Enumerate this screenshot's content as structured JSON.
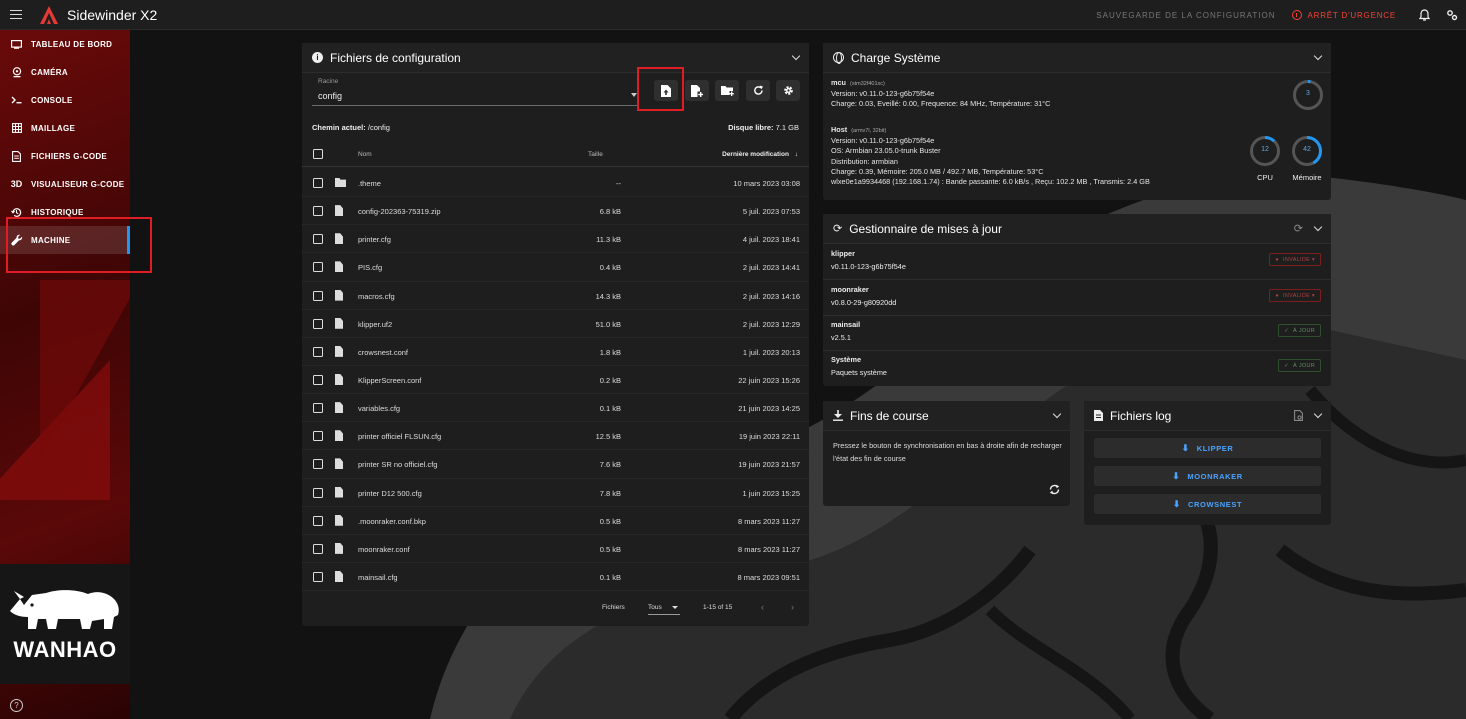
{
  "app": {
    "title": "Sidewinder X2"
  },
  "topbar": {
    "save_config": "SAUVEGARDE DE LA CONFIGURATION",
    "emergency_stop": "ARRÊT D'URGENCE"
  },
  "sidebar": {
    "items": [
      {
        "label": "TABLEAU DE BORD",
        "icon": "dashboard-icon"
      },
      {
        "label": "CAMÉRA",
        "icon": "webcam-icon"
      },
      {
        "label": "CONSOLE",
        "icon": "console-icon"
      },
      {
        "label": "MAILLAGE",
        "icon": "grid-icon"
      },
      {
        "label": "FICHIERS G-CODE",
        "icon": "file-document-icon"
      },
      {
        "label": "VISUALISEUR G-CODE",
        "icon": "3d-icon"
      },
      {
        "label": "HISTORIQUE",
        "icon": "history-icon"
      },
      {
        "label": "MACHINE",
        "icon": "wrench-icon"
      }
    ],
    "active": "MACHINE",
    "brand": "WANHAO",
    "icon_3d_text": "3D"
  },
  "files": {
    "title": "Fichiers de configuration",
    "root_label": "Racine",
    "root_value": "config",
    "current_path_label": "Chemin actuel:",
    "current_path": "/config",
    "free_disk_label": "Disque libre:",
    "free_disk": "7.1 GB",
    "columns": {
      "name": "Nom",
      "size": "Taille",
      "modified": "Dernière modification"
    },
    "rows": [
      {
        "name": ".theme",
        "size": "--",
        "date": "10 mars 2023 03:08",
        "type": "folder"
      },
      {
        "name": "config-202363-75319.zip",
        "size": "6.8 kB",
        "date": "5 juil. 2023 07:53",
        "type": "file"
      },
      {
        "name": "printer.cfg",
        "size": "11.3 kB",
        "date": "4 juil. 2023 18:41",
        "type": "file"
      },
      {
        "name": "PIS.cfg",
        "size": "0.4 kB",
        "date": "2 juil. 2023 14:41",
        "type": "file"
      },
      {
        "name": "macros.cfg",
        "size": "14.3 kB",
        "date": "2 juil. 2023 14:16",
        "type": "file"
      },
      {
        "name": "klipper.uf2",
        "size": "51.0 kB",
        "date": "2 juil. 2023 12:29",
        "type": "file"
      },
      {
        "name": "crowsnest.conf",
        "size": "1.8 kB",
        "date": "1 juil. 2023 20:13",
        "type": "file"
      },
      {
        "name": "KlipperScreen.conf",
        "size": "0.2 kB",
        "date": "22 juin 2023 15:26",
        "type": "file"
      },
      {
        "name": "variables.cfg",
        "size": "0.1 kB",
        "date": "21 juin 2023 14:25",
        "type": "file"
      },
      {
        "name": "printer officiel FLSUN.cfg",
        "size": "12.5 kB",
        "date": "19 juin 2023 22:11",
        "type": "file"
      },
      {
        "name": "printer SR no officiel.cfg",
        "size": "7.6 kB",
        "date": "19 juin 2023 21:57",
        "type": "file"
      },
      {
        "name": "printer D12 500.cfg",
        "size": "7.8 kB",
        "date": "1 juin 2023 15:25",
        "type": "file"
      },
      {
        "name": ".moonraker.conf.bkp",
        "size": "0.5 kB",
        "date": "8 mars 2023 11:27",
        "type": "file"
      },
      {
        "name": "moonraker.conf",
        "size": "0.5 kB",
        "date": "8 mars 2023 11:27",
        "type": "file"
      },
      {
        "name": "mainsail.cfg",
        "size": "0.1 kB",
        "date": "8 mars 2023 09:51",
        "type": "file"
      }
    ],
    "footer": {
      "rows_label": "Fichiers",
      "rows_select": "Tous",
      "range": "1-15 of 15"
    }
  },
  "system": {
    "title": "Charge Système",
    "mcu": {
      "name": "mcu",
      "chip": "(stm32f401xc)",
      "version": "Version: v0.11.0-123-g6b75f54e",
      "stats": "Charge: 0.03, Eveillé: 0.00, Frequence: 84 MHz, Température: 31°C",
      "load": "3"
    },
    "host": {
      "name": "Host",
      "arch": "(armv7l, 32bit)",
      "version": "Version: v0.11.0-123-g6b75f54e",
      "os": "OS: Armbian 23.05.0-trunk Buster",
      "distribution": "Distribution: armbian",
      "stats": "Charge: 0.39, Mémoire: 205.0 MB / 492.7 MB, Température: 53°C",
      "network": "wlxe0e1a9934468 (192.168.1.74) : Bande passante: 6.0 kB/s , Reçu: 102.2 MB , Transmis: 2.4 GB",
      "cpu": "12",
      "cpu_label": "CPU",
      "memory": "42",
      "memory_label": "Mémoire"
    }
  },
  "updates": {
    "title": "Gestionnaire de mises à jour",
    "items": [
      {
        "name": "klipper",
        "version": "v0.11.0-123-g6b75f54e",
        "status": "INVALIDE",
        "state": "bad"
      },
      {
        "name": "moonraker",
        "version": "v0.8.0-29-g80920dd",
        "status": "INVALIDE",
        "state": "bad"
      },
      {
        "name": "mainsail",
        "version": "v2.5.1",
        "status": "À JOUR",
        "state": "ok"
      },
      {
        "name": "Système",
        "version": "Paquets système",
        "status": "À JOUR",
        "state": "ok"
      }
    ]
  },
  "endstops": {
    "title": "Fins de course",
    "text": "Pressez le bouton de synchronisation en bas à droite afin de recharger l'état des fin de course"
  },
  "logs": {
    "title": "Fichiers log",
    "buttons": [
      "KLIPPER",
      "MOONRAKER",
      "CROWSNEST"
    ]
  },
  "colors": {
    "accent": "#2196f3",
    "danger": "#f44336",
    "highlight": "#e01c24",
    "brand_red": "#b71c1c"
  }
}
